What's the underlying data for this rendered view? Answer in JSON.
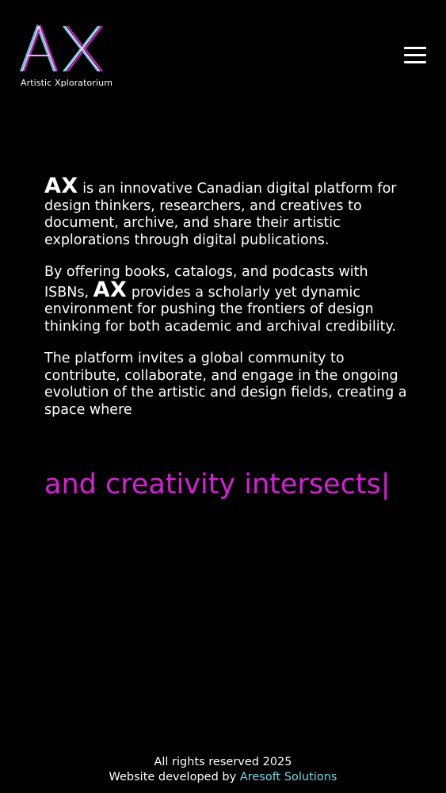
{
  "header": {
    "logo_text": "AX",
    "logo_tagline": "Artistic Xploratorium",
    "menu_icon": "hamburger-menu-icon"
  },
  "intro": {
    "p1_mark": "AX",
    "p1_text": " is an innovative Canadian digital platform for design thinkers, researchers, and creatives to document, archive, and share their artistic explorations through digital publications.",
    "p2_text_a": "By offering books, catalogs, and podcasts with ISBNs, ",
    "p2_mark": "AX",
    "p2_text_b": " provides a scholarly yet dynamic environment for pushing the frontiers of design thinking for both academic and archival credibility.",
    "p3_text": "The platform invites a global community to contribute, collaborate, and engage in the ongoing evolution of the artistic and design fields, creating a space where"
  },
  "typing_text": "and creativity intersects|",
  "footer": {
    "rights": "All rights reserved 2025",
    "developed_prefix": "Website developed by ",
    "developer_link": "Aresoft Solutions"
  },
  "colors": {
    "background": "#000000",
    "text": "#ffffff",
    "accent_magenta": "#d91ed8",
    "accent_cyan": "#6fd8e6"
  }
}
